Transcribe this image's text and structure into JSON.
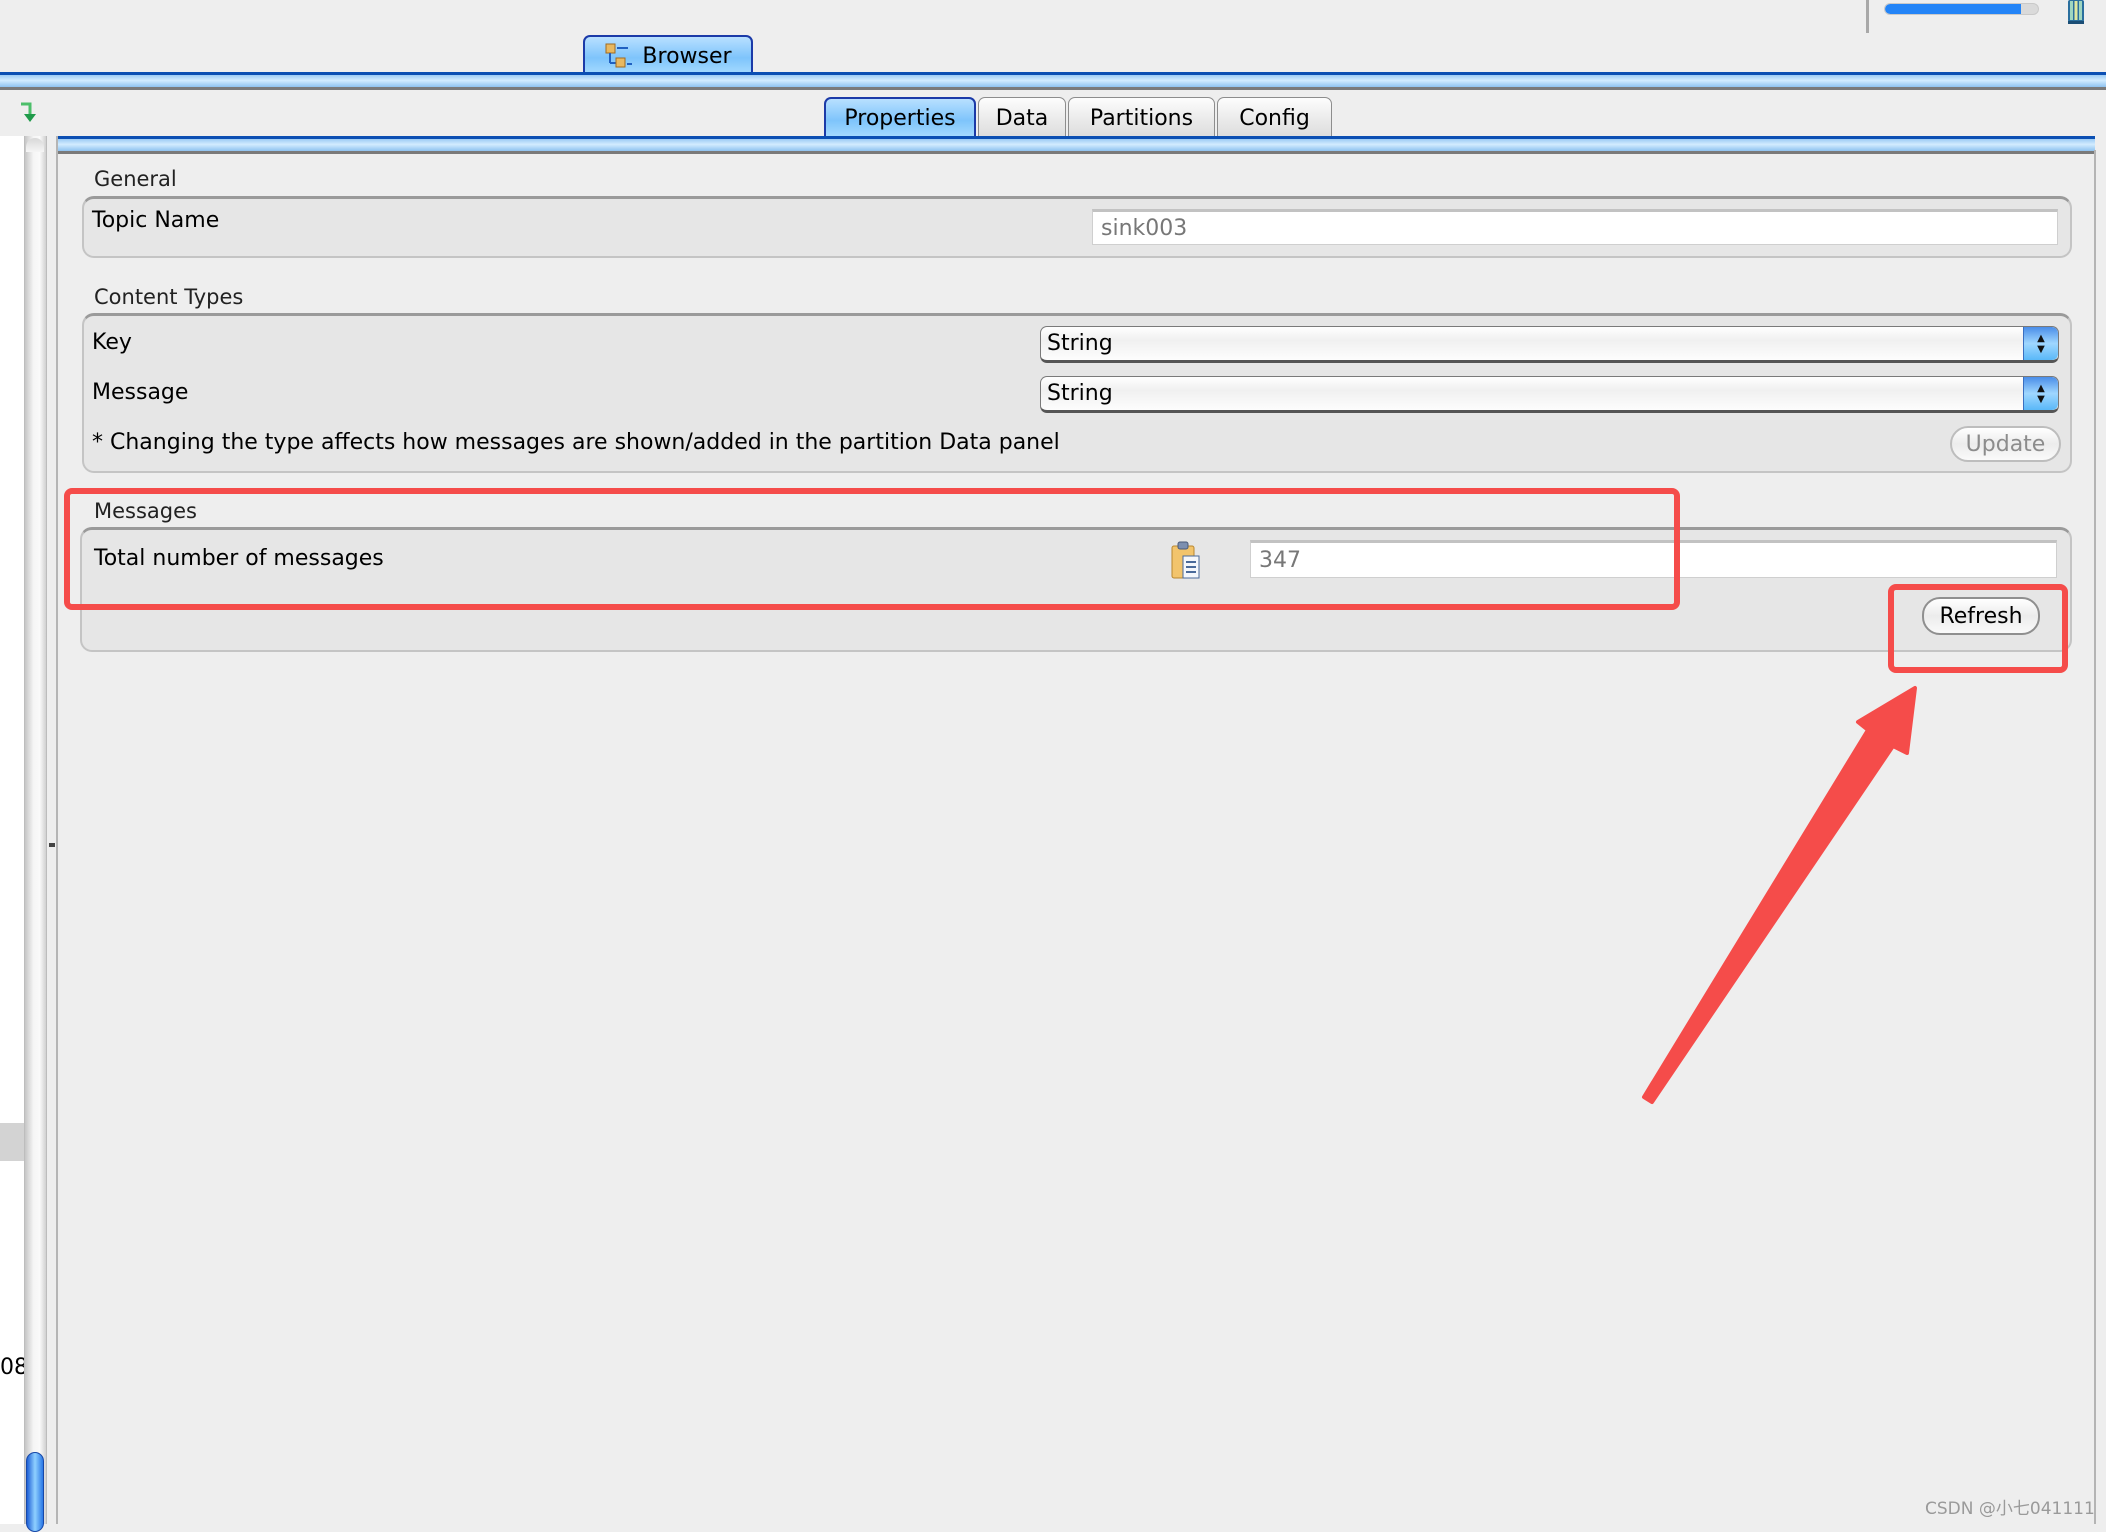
{
  "toolbar": {
    "memory_usage_fraction": 0.89,
    "icons": {
      "trash": "trash-icon",
      "memory": "memory-bar"
    }
  },
  "outer_tabs": [
    {
      "label": "Browser",
      "icon": "tree-icon",
      "active": true
    }
  ],
  "left_panel": {
    "toolbar_icon": "green-down-arrow-icon",
    "partial_text": "08"
  },
  "inner_tabs": [
    {
      "label": "Properties",
      "active": true
    },
    {
      "label": "Data",
      "active": false
    },
    {
      "label": "Partitions",
      "active": false
    },
    {
      "label": "Config",
      "active": false
    }
  ],
  "general": {
    "title": "General",
    "topic_name_label": "Topic Name",
    "topic_name_value": "sink003"
  },
  "content_types": {
    "title": "Content Types",
    "key_label": "Key",
    "key_value": "String",
    "message_label": "Message",
    "message_value": "String",
    "note": "* Changing the type affects how messages are shown/added in the partition Data panel",
    "update_label": "Update"
  },
  "messages": {
    "title": "Messages",
    "total_label": "Total number of messages",
    "total_value": "347",
    "copy_icon": "clipboard-icon",
    "refresh_label": "Refresh"
  },
  "annotations": {
    "color": "#f54c4a",
    "highlight_messages": true,
    "highlight_refresh": true,
    "arrow_points_to": "refresh-button"
  },
  "watermark": "CSDN @小七041111"
}
